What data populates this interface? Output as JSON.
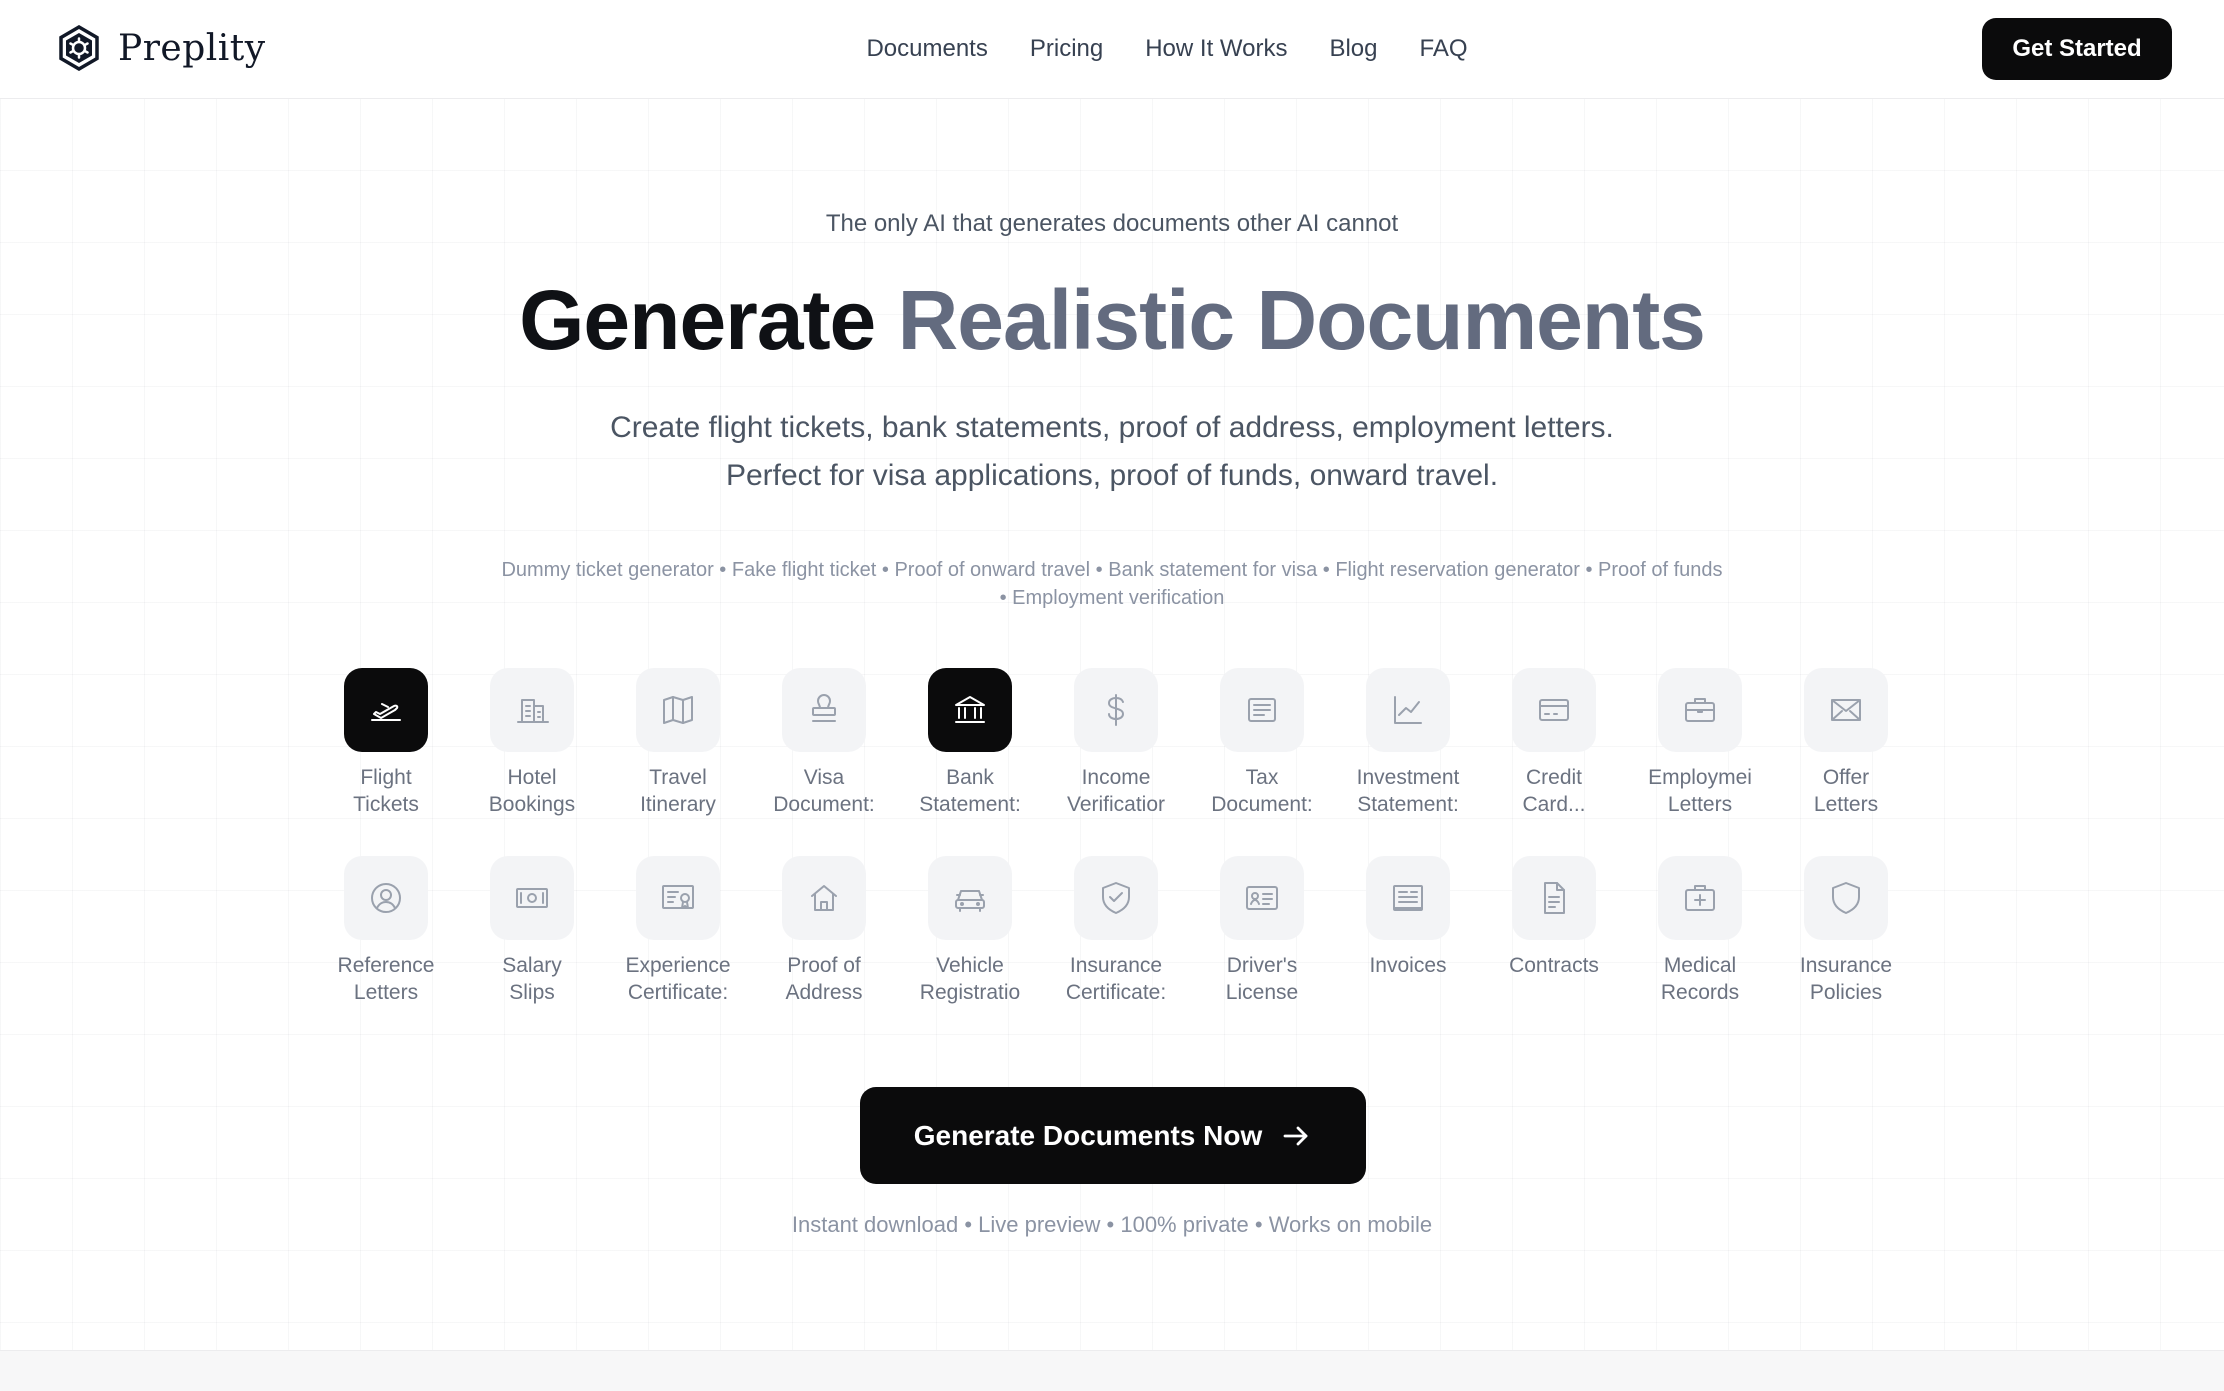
{
  "brand": {
    "name": "Preplity",
    "logo_icon": "hexagon-gear-icon"
  },
  "nav": {
    "links": [
      "Documents",
      "Pricing",
      "How It Works",
      "Blog",
      "FAQ"
    ],
    "cta_label": "Get Started"
  },
  "hero": {
    "tagline": "The only AI that generates documents other AI cannot",
    "headline_dark": "Generate",
    "headline_accent": "Realistic Documents",
    "subtext_line1": "Create flight tickets, bank statements, proof of address, employment letters.",
    "subtext_line2": "Perfect for visa applications, proof of funds, onward travel.",
    "keywords_line1": "Dummy ticket generator • Fake flight ticket • Proof of onward travel • Bank statement for visa • Flight reservation generator • Proof of funds",
    "keywords_line2": "• Employment verification"
  },
  "documents": [
    {
      "line1": "Flight",
      "line2": "Tickets",
      "icon": "plane-icon",
      "active": true
    },
    {
      "line1": "Hotel",
      "line2": "Bookings",
      "icon": "building-icon",
      "active": false
    },
    {
      "line1": "Travel",
      "line2": "Itinerary",
      "icon": "map-icon",
      "active": false
    },
    {
      "line1": "Visa",
      "line2": "Document:",
      "icon": "stamp-icon",
      "active": false
    },
    {
      "line1": "Bank",
      "line2": "Statement:",
      "icon": "bank-icon",
      "active": true
    },
    {
      "line1": "Income",
      "line2": "Verificatior",
      "icon": "dollar-icon",
      "active": false
    },
    {
      "line1": "Tax",
      "line2": "Document:",
      "icon": "receipt-icon",
      "active": false
    },
    {
      "line1": "Investment",
      "line2": "Statement:",
      "icon": "chart-line-icon",
      "active": false
    },
    {
      "line1": "Credit",
      "line2": "Card...",
      "icon": "credit-card-icon",
      "active": false
    },
    {
      "line1": "Employmei",
      "line2": "Letters",
      "icon": "briefcase-icon",
      "active": false
    },
    {
      "line1": "Offer",
      "line2": "Letters",
      "icon": "envelope-icon",
      "active": false
    },
    {
      "line1": "Reference",
      "line2": "Letters",
      "icon": "user-circle-icon",
      "active": false
    },
    {
      "line1": "Salary",
      "line2": "Slips",
      "icon": "banknote-icon",
      "active": false
    },
    {
      "line1": "Experience",
      "line2": "Certificate:",
      "icon": "certificate-icon",
      "active": false
    },
    {
      "line1": "Proof of",
      "line2": "Address",
      "icon": "home-icon",
      "active": false
    },
    {
      "line1": "Vehicle",
      "line2": "Registratio",
      "icon": "car-icon",
      "active": false
    },
    {
      "line1": "Insurance",
      "line2": "Certificate:",
      "icon": "shield-check-icon",
      "active": false
    },
    {
      "line1": "Driver's",
      "line2": "License",
      "icon": "id-card-icon",
      "active": false
    },
    {
      "line1": "Invoices",
      "line2": "",
      "icon": "invoice-icon",
      "active": false
    },
    {
      "line1": "Contracts",
      "line2": "",
      "icon": "document-icon",
      "active": false
    },
    {
      "line1": "Medical",
      "line2": "Records",
      "icon": "medical-case-icon",
      "active": false
    },
    {
      "line1": "Insurance",
      "line2": "Policies",
      "icon": "shield-icon",
      "active": false
    }
  ],
  "cta": {
    "label": "Generate Documents Now",
    "icon": "arrow-right-icon"
  },
  "features_line": "Instant download • Live preview • 100% private • Works on mobile",
  "colors": {
    "accent_gray": "#636b7f",
    "button_black": "#0b0b0c",
    "icon_bg": "#f3f4f6"
  }
}
